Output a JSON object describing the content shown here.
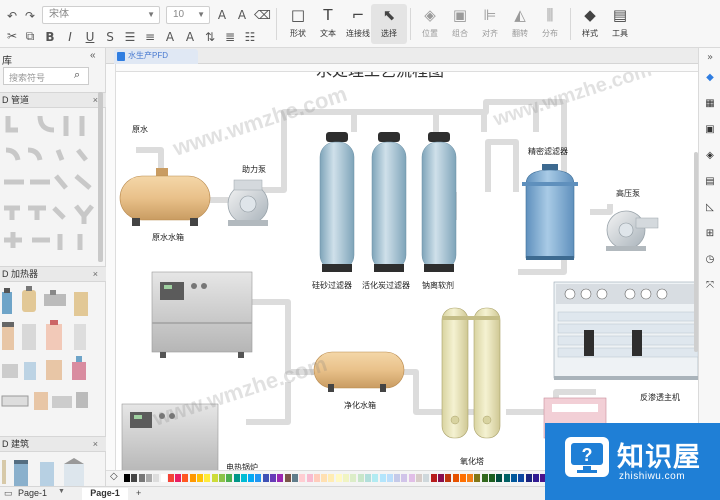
{
  "toolbar": {
    "font_name": "宋体",
    "font_size": "10",
    "groups": [
      {
        "key": "shape",
        "label": "形状",
        "icon": "square-icon"
      },
      {
        "key": "text",
        "label": "文本",
        "icon": "text-icon"
      },
      {
        "key": "connector",
        "label": "连接线",
        "icon": "connector-icon"
      },
      {
        "key": "select",
        "label": "选择",
        "icon": "pointer-icon"
      }
    ],
    "dim_groups": [
      {
        "key": "position",
        "label": "位置",
        "icon": "layers-icon"
      },
      {
        "key": "group",
        "label": "组合",
        "icon": "group-icon"
      },
      {
        "key": "align",
        "label": "对齐",
        "icon": "align-icon"
      },
      {
        "key": "flip",
        "label": "翻转",
        "icon": "flip-icon"
      },
      {
        "key": "distribute",
        "label": "分布",
        "icon": "distribute-icon"
      }
    ],
    "style_label": "样式",
    "tools_label": "工具"
  },
  "left_panel": {
    "title": "库",
    "search_placeholder": "搜索符号",
    "categories": [
      {
        "label": "D 管道"
      },
      {
        "label": "D 加热器"
      },
      {
        "label": "D 建筑"
      }
    ]
  },
  "document": {
    "tab_label": "水生产PFD",
    "title_partial": "水处理工艺流程图"
  },
  "diagram": {
    "labels": {
      "raw_water": "原水",
      "raw_tank": "原水水箱",
      "booster_pump": "助力泵",
      "sand_filter": "硅砂过滤器",
      "carbon_filter": "活化炭过滤器",
      "softener": "钠离软剂",
      "precision_filter": "精密滤滤器",
      "high_pump": "高压泵",
      "clean_tank": "净化水箱",
      "ro_machine": "反渗透主机",
      "oxidation_tower": "氧化塔",
      "bottom_cut": "电热锅炉"
    }
  },
  "pages": {
    "selector_label": "Page-1",
    "active_tab": "Page-1",
    "add_label": "+"
  },
  "watermark": {
    "text": "www.wmzhe.com"
  },
  "logo": {
    "title": "知识屋",
    "url": "zhishiwu.com"
  },
  "colors": {
    "accent": "#2f7de1",
    "pipe": "#dcdcdc",
    "tank": "#e7c08a",
    "filter": "#9fbfd0",
    "logo_bg": "#1f7fd6"
  },
  "palette": [
    "#000000",
    "#444444",
    "#777777",
    "#aaaaaa",
    "#dddddd",
    "#ffffff",
    "#f44336",
    "#e91e63",
    "#ff5722",
    "#ff9800",
    "#ffc107",
    "#ffeb3b",
    "#cddc39",
    "#8bc34a",
    "#4caf50",
    "#009688",
    "#00bcd4",
    "#03a9f4",
    "#2196f3",
    "#3f51b5",
    "#673ab7",
    "#9c27b0",
    "#795548",
    "#607d8b",
    "#ffcdd2",
    "#f8bbd0",
    "#ffccbc",
    "#ffe0b2",
    "#ffecb3",
    "#fff9c4",
    "#f0f4c3",
    "#dcedc8",
    "#c8e6c9",
    "#b2dfdb",
    "#b2ebf2",
    "#b3e5fc",
    "#bbdefb",
    "#c5cae9",
    "#d1c4e9",
    "#e1bee7",
    "#d7ccc8",
    "#cfd8dc",
    "#b71c1c",
    "#880e4f",
    "#bf360c",
    "#e65100",
    "#ff6f00",
    "#f57f17",
    "#827717",
    "#33691e",
    "#1b5e20",
    "#004d40",
    "#006064",
    "#01579b",
    "#0d47a1",
    "#1a237e",
    "#311b92",
    "#4a148c",
    "#3e2723",
    "#263238",
    "#ef9a9a",
    "#f48fb1",
    "#ffab91",
    "#ffcc80",
    "#ffe082",
    "#fff59d",
    "#e6ee9c",
    "#c5e1a5",
    "#a5d6a7",
    "#80cbc4",
    "#80deea",
    "#81d4fa",
    "#90caf9",
    "#9fa8da"
  ]
}
